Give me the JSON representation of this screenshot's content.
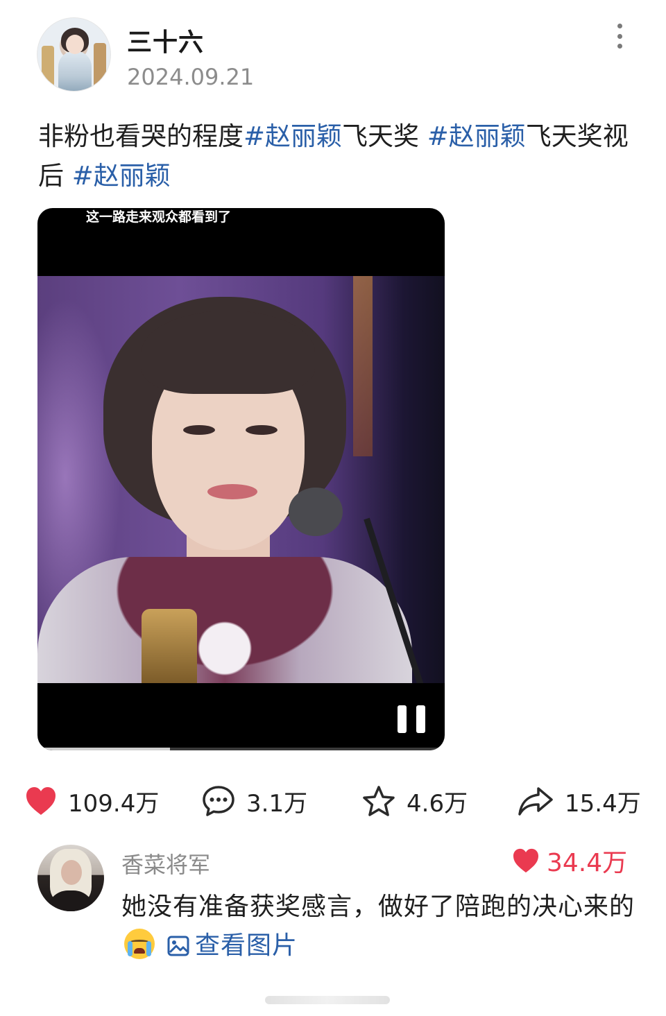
{
  "post": {
    "username": "三十六",
    "date": "2024.09.21",
    "text_plain_1": "非粉也看哭的程度",
    "hashtag_1": "#赵丽颖",
    "text_plain_2": "飞天奖 ",
    "hashtag_2": "#赵丽颖",
    "text_plain_3": "飞天奖视后 ",
    "hashtag_3": "#赵丽颖"
  },
  "video": {
    "caption": "这一路走来观众都看到了",
    "progress": 0.325,
    "state": "playing"
  },
  "actions": {
    "likes": "109.4万",
    "comments": "3.1万",
    "favorites": "4.6万",
    "shares": "15.4万"
  },
  "comment": {
    "username": "香菜将军",
    "likes": "34.4万",
    "text": "她没有准备获奖感言，做好了陪跑的决心来的",
    "view_image_label": "查看图片"
  },
  "colors": {
    "hashtag": "#2a5fa8",
    "like_red": "#ea3a50",
    "muted_text": "#8a8a8a"
  },
  "icons": [
    "more-icon",
    "heart-icon",
    "comment-icon",
    "star-icon",
    "share-icon",
    "pause-icon",
    "image-icon",
    "crying-emoji"
  ]
}
